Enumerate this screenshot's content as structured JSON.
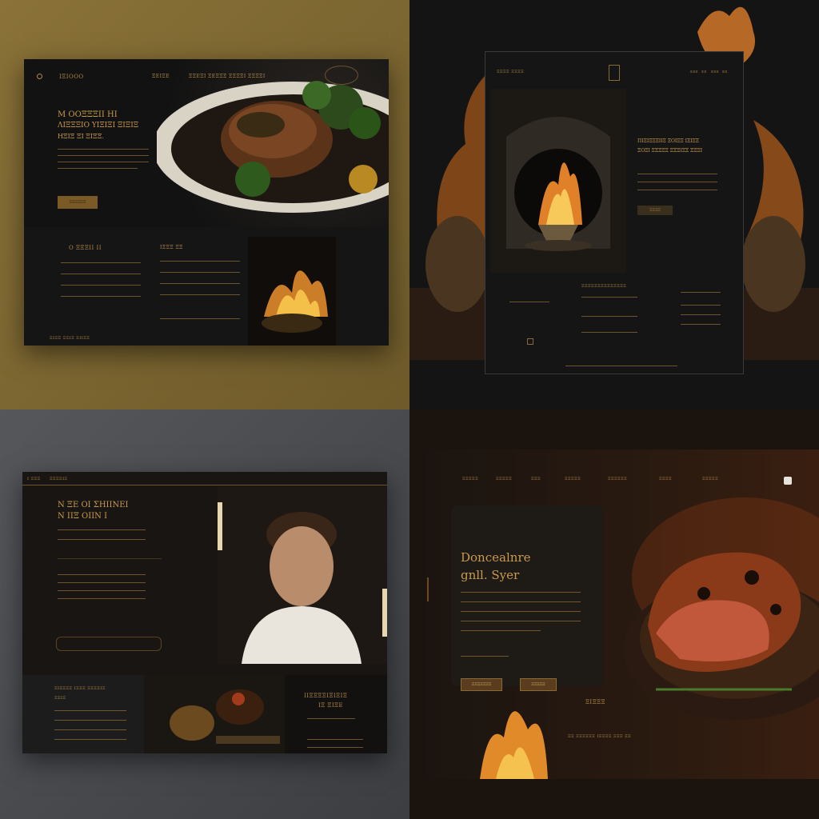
{
  "q1": {
    "logo": "ΙΞΙΟΟΟ",
    "nav": [
      "ΞΕΙΞΕ",
      "ΞΞΕΞΙ",
      "ΞΕΞΞΞ",
      "ΞΞΞΞΙ",
      "ΞΞΞΞΙ"
    ],
    "headline_1": "Μ ΟΟΞΞΞΙΙ ΗΙ",
    "headline_2": "ΛΙΞΞΞΙΟ ΥΙΞΙΞΙ ΞΙΞΙΞ",
    "headline_3": "ΗΞΙΞ ΞΙ ΞΙΞΞ.",
    "cta": "ΞΞΞΞΞΞ",
    "section_1": "Ο ΞΞΞΙΙ ΙΙ",
    "section_2": "ΙΞΞΞ ΞΞ",
    "footer": "ΞΙΞΞ ΞΞΙΞ ΞΙΙΞΞ"
  },
  "q2": {
    "brand": "ΞΞΞΞ ΞΞΞΞ",
    "nav": [
      "ΞΞΞ",
      "ΞΞ",
      "ΞΞΞ",
      "ΞΞ"
    ],
    "headline_1": "ΠΙΞΙΞΞΞΙΙΞ ΞΟΙΞΞ ΙΞΙΞΞ",
    "headline_2": "ΞΟΞΙ ΞΞΞΞΞ ΞΞΞΙΞΞ ΞΞΞΙ",
    "cta": "ΞΞΞΞ",
    "section_title": "ΞΞΞΞΞΞΞΞΞΞΞΞΞΞ"
  },
  "q3": {
    "topbar": [
      "Ι ΞΞΞ",
      "ΞΞΞΞΙΞ"
    ],
    "headline_1": "Ν ΞΕ ΟΙ ΣΗΙΙΝΕΙ",
    "headline_2": "Ν ΙΙΞ ΟΙΙΝ Ι",
    "card_title_1": "ΞΙΞΞΞΞ ΙΞΞΞ ΞΞΞΞΙΞ",
    "card_title_2": "ΞΞΙΞ",
    "panel_title_1": "ΙΙΞΞΞΞΙΞΙΞΙΞ",
    "panel_title_2": "ΙΞ ΞΙΞΕ"
  },
  "q4": {
    "nav": [
      "ΞΞΞΞΞ",
      "ΞΞΞΞΞ",
      "ΞΞΞ",
      "ΞΞΞΞΞ",
      "ΞΞΞΞΞΞ",
      "ΞΞΞΞ",
      "ΞΞΞΞΞ"
    ],
    "headline_1": "Doncealnre",
    "headline_2": "gnll. Syer",
    "button_1": "ΞΞΞΞΞΞΞ",
    "button_2": "ΞΞΞΞΞ",
    "label": "ΞΙΞΞΞ",
    "footer_line": "ΞΞ ΞΞΞΞΞΞ ΙΞΞΞΞ ΞΞΞ ΞΞ"
  }
}
